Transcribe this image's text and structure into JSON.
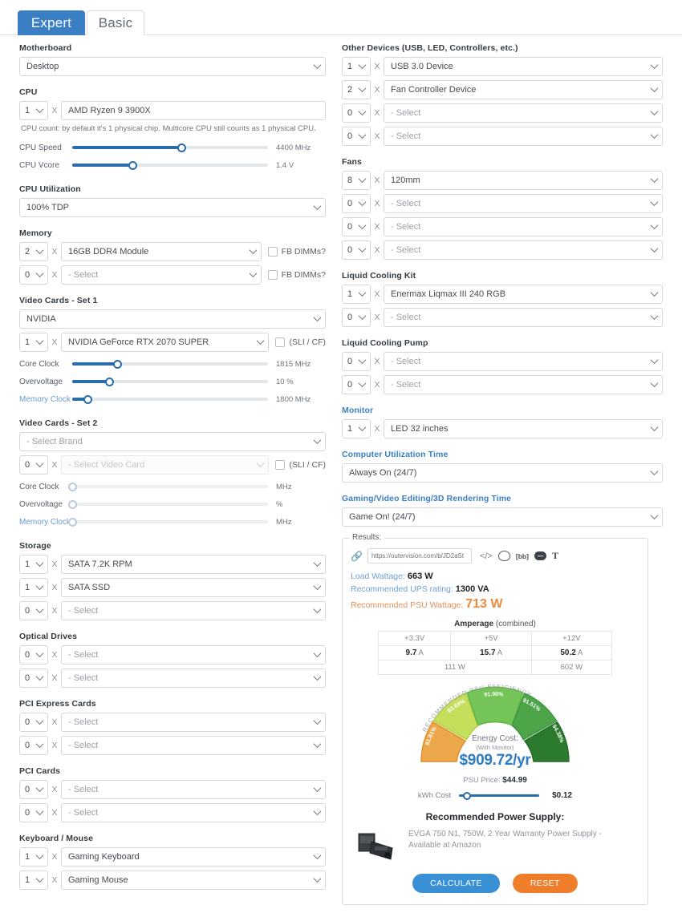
{
  "tabs": [
    {
      "label": "Expert",
      "active": true
    },
    {
      "label": "Basic",
      "active": false
    }
  ],
  "left": {
    "motherboard": {
      "label": "Motherboard",
      "value": "Desktop"
    },
    "cpu": {
      "label": "CPU",
      "qty": "1",
      "value": "AMD Ryzen 9 3900X",
      "hint": "CPU count: by default it's 1 physical chip. Multicore CPU still counts as 1 physical CPU.",
      "sliders": [
        {
          "name": "CPU Speed",
          "value": "4400 MHz",
          "pct": 56
        },
        {
          "name": "CPU Vcore",
          "value": "1.4 V",
          "pct": 31
        }
      ]
    },
    "cpu_utilization": {
      "label": "CPU Utilization",
      "value": "100% TDP"
    },
    "memory": {
      "label": "Memory",
      "rows": [
        {
          "qty": "2",
          "value": "16GB DDR4 Module",
          "checkbox_label": "FB DIMMs?"
        },
        {
          "qty": "0",
          "value": "- Select",
          "checkbox_label": "FB DIMMs?"
        }
      ]
    },
    "video_set1": {
      "label": "Video Cards - Set 1",
      "brand": "NVIDIA",
      "qty": "1",
      "card": "NVIDIA GeForce RTX 2070 SUPER",
      "checkbox_label": "(SLI / CF)",
      "sliders": [
        {
          "name": "Core Clock",
          "value": "1815 MHz",
          "pct": 23
        },
        {
          "name": "Overvoltage",
          "value": "10 %",
          "pct": 19
        },
        {
          "name": "Memory Clock",
          "value": "1800 MHz",
          "pct": 8
        }
      ]
    },
    "video_set2": {
      "label": "Video Cards - Set 2",
      "brand": "- Select Brand",
      "qty": "0",
      "card": "- Select Video Card",
      "checkbox_label": "(SLI / CF)",
      "sliders": [
        {
          "name": "Core Clock",
          "value": "MHz",
          "pct": 0
        },
        {
          "name": "Overvoltage",
          "value": "%",
          "pct": 0
        },
        {
          "name": "Memory Clock",
          "value": "MHz",
          "pct": 0
        }
      ]
    },
    "storage": {
      "label": "Storage",
      "rows": [
        {
          "qty": "1",
          "value": "SATA 7.2K RPM"
        },
        {
          "qty": "1",
          "value": "SATA SSD"
        },
        {
          "qty": "0",
          "value": "- Select"
        }
      ]
    },
    "optical": {
      "label": "Optical Drives",
      "rows": [
        {
          "qty": "0",
          "value": "- Select"
        },
        {
          "qty": "0",
          "value": "- Select"
        }
      ]
    },
    "pcie": {
      "label": "PCI Express Cards",
      "rows": [
        {
          "qty": "0",
          "value": "- Select"
        },
        {
          "qty": "0",
          "value": "- Select"
        }
      ]
    },
    "pci": {
      "label": "PCI Cards",
      "rows": [
        {
          "qty": "0",
          "value": "- Select"
        },
        {
          "qty": "0",
          "value": "- Select"
        }
      ]
    },
    "keyboard_mouse": {
      "label": "Keyboard / Mouse",
      "rows": [
        {
          "qty": "1",
          "value": "Gaming Keyboard"
        },
        {
          "qty": "1",
          "value": "Gaming Mouse"
        }
      ]
    }
  },
  "right": {
    "other_devices": {
      "label": "Other Devices (USB, LED, Controllers, etc.)",
      "rows": [
        {
          "qty": "1",
          "value": "USB 3.0 Device"
        },
        {
          "qty": "2",
          "value": "Fan Controller Device"
        },
        {
          "qty": "0",
          "value": "- Select"
        },
        {
          "qty": "0",
          "value": "- Select"
        }
      ]
    },
    "fans": {
      "label": "Fans",
      "rows": [
        {
          "qty": "8",
          "value": "120mm"
        },
        {
          "qty": "0",
          "value": "- Select"
        },
        {
          "qty": "0",
          "value": "- Select"
        },
        {
          "qty": "0",
          "value": "- Select"
        }
      ]
    },
    "liquid_cooling_kit": {
      "label": "Liquid Cooling Kit",
      "rows": [
        {
          "qty": "1",
          "value": "Enermax Liqmax III 240 RGB"
        },
        {
          "qty": "0",
          "value": "- Select"
        }
      ]
    },
    "liquid_cooling_pump": {
      "label": "Liquid Cooling Pump",
      "rows": [
        {
          "qty": "0",
          "value": "- Select"
        },
        {
          "qty": "0",
          "value": "- Select"
        }
      ]
    },
    "monitor": {
      "label": "Monitor",
      "qty": "1",
      "value": "LED 32 inches"
    },
    "computer_utilization_time": {
      "label": "Computer Utilization Time",
      "value": "Always On (24/7)"
    },
    "gaming_time": {
      "label": "Gaming/Video Editing/3D Rendering Time",
      "value": "Game On! (24/7)"
    }
  },
  "results": {
    "legend": "Results:",
    "share_url": "https://outervision.com/b/JD2aSt",
    "share_buttons": [
      {
        "name": "embed-code-icon",
        "glyph": "</>"
      },
      {
        "name": "reddit-icon",
        "glyph": ""
      },
      {
        "name": "bbcode-icon",
        "glyph": "[bb]"
      },
      {
        "name": "shorturl-icon",
        "glyph": "—"
      },
      {
        "name": "text-icon",
        "glyph": "T"
      }
    ],
    "stats": [
      {
        "key": "Load Wattage:",
        "value": "663 W",
        "big": false
      },
      {
        "key": "Recommended UPS rating:",
        "value": "1300 VA",
        "big": false
      },
      {
        "key": "Recommended PSU Wattage:",
        "value": "713 W",
        "big": true
      }
    ],
    "amperage": {
      "title_bold": "Amperage",
      "title_rest": " (combined)",
      "headers": [
        "+3.3V",
        "+5V",
        "+12V"
      ],
      "amps": [
        "9.7",
        "15.7",
        "50.2"
      ],
      "amp_unit": "A",
      "watts": [
        "111 W",
        "602 W"
      ]
    },
    "gauge": {
      "arc_label": "RECOMMENDED PSU EFFICIENCY",
      "segments": [
        {
          "label": "81.81%",
          "color": "#eca84a",
          "stroke": "#e08b28"
        },
        {
          "label": "83.69%",
          "color": "#c5de5b",
          "stroke": "#b2cf43"
        },
        {
          "label": "91.98%",
          "color": "#74c457",
          "stroke": "#5fb443"
        },
        {
          "label": "91.51%",
          "color": "#4da54a",
          "stroke": "#3f9440"
        },
        {
          "label": "94.38%",
          "color": "#2c7a2e",
          "stroke": "#256b28"
        }
      ],
      "energy_cost_label": "Energy Cost:",
      "with_monitor": "(With Monitor)",
      "cost": "$909.72/yr"
    },
    "psu_price_label": "PSU Price:",
    "psu_price_value": "$44.99",
    "kwh_label": "kWh Cost",
    "kwh_value": "$0.12",
    "kwh_pct": 20,
    "recommended_title": "Recommended Power Supply:",
    "recommended_product": "EVGA 750 N1, 750W, 2 Year Warranty Power Supply - Available at Amazon",
    "calculate_label": "CALCULATE",
    "reset_label": "RESET"
  },
  "colors": {
    "accent_blue": "#3a7fc4",
    "orange": "#ef8a3b",
    "reset_orange": "#f07d2a",
    "cost_blue": "#2e7cc4"
  }
}
